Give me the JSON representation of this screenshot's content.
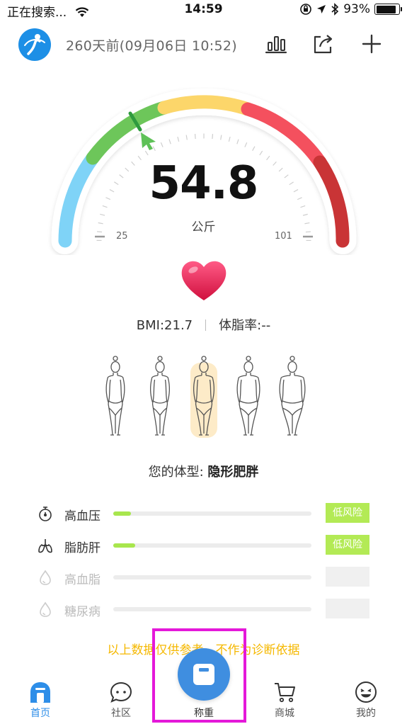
{
  "status_bar": {
    "carrier": "正在搜索...",
    "time": "14:59",
    "battery": "93%",
    "battery_level": 0.93
  },
  "header": {
    "title": "260天前(09月06日 10:52)"
  },
  "gauge": {
    "value": "54.8",
    "unit": "公斤",
    "min_label": "25",
    "max_label": "101"
  },
  "metrics": {
    "bmi": "BMI:21.7",
    "body_fat": "体脂率:--"
  },
  "body_type": {
    "prefix": "您的体型: ",
    "value": "隐形肥胖",
    "selected_index": 2
  },
  "risks": [
    {
      "label": "高血压",
      "level": 0.09,
      "badge": "低风险",
      "icon": "timer-icon",
      "enabled": true
    },
    {
      "label": "脂肪肝",
      "level": 0.11,
      "badge": "低风险",
      "icon": "lungs-icon",
      "enabled": true
    },
    {
      "label": "高血脂",
      "level": 0,
      "badge": "",
      "icon": "drop-icon",
      "enabled": false
    },
    {
      "label": "糖尿病",
      "level": 0,
      "badge": "",
      "icon": "drop-icon",
      "enabled": false
    }
  ],
  "disclaimer": "以上数据仅供参考，不作为诊断依据",
  "tabs": [
    {
      "label": "首页",
      "icon": "home-icon"
    },
    {
      "label": "社区",
      "icon": "chat-icon"
    },
    {
      "label": "称重",
      "icon": "scale-icon"
    },
    {
      "label": "商城",
      "icon": "cart-icon"
    },
    {
      "label": "我的",
      "icon": "smile-icon"
    }
  ],
  "colors": {
    "accent": "#3f8ee0",
    "risk_low": "#b3ea55",
    "disclaimer": "#f5b800",
    "highlight": "#e418d9"
  }
}
